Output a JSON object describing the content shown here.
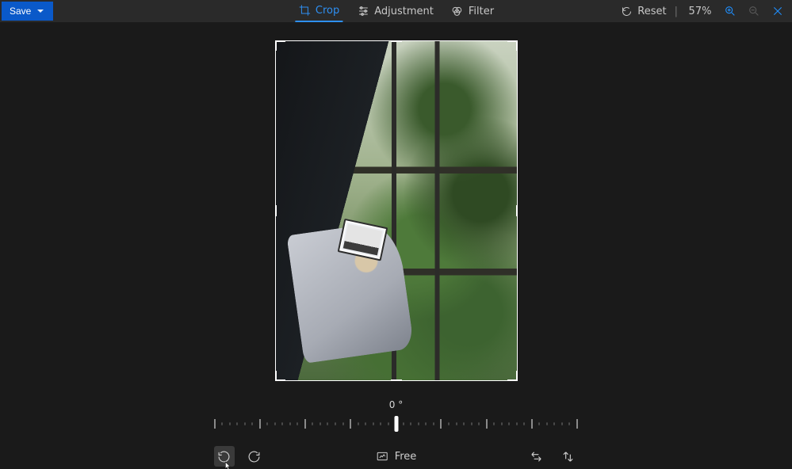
{
  "toolbar": {
    "save_label": "Save",
    "tabs": {
      "crop": "Crop",
      "adjustment": "Adjustment",
      "filter": "Filter"
    },
    "active_tab": "crop",
    "reset_label": "Reset",
    "zoom_percent": "57%"
  },
  "rotation": {
    "angle_label": "0 °",
    "angle_deg": 0
  },
  "aspect": {
    "mode_label": "Free"
  }
}
